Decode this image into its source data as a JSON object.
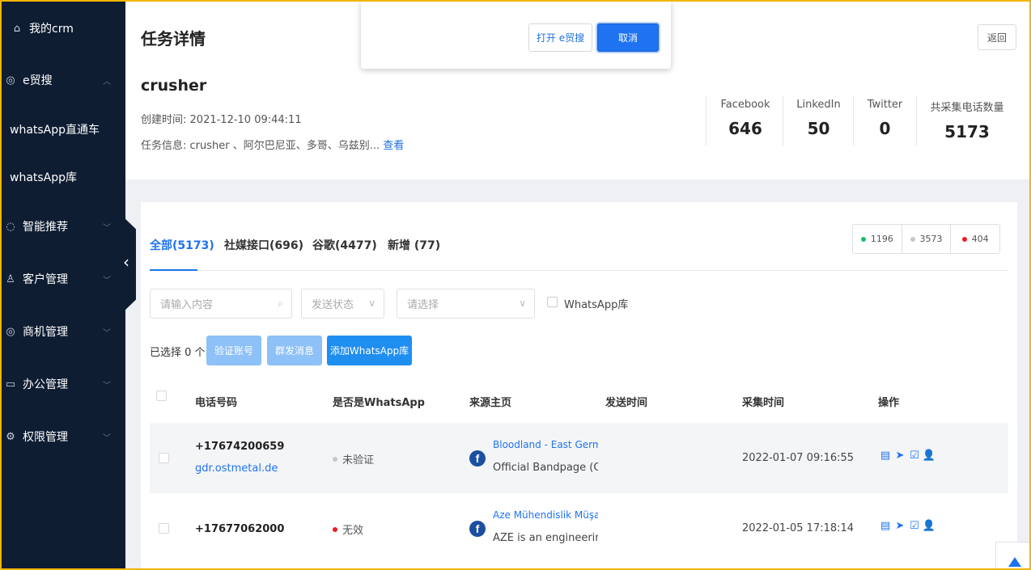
{
  "sidebar": {
    "home": "我的crm",
    "esearch": "e贸搜",
    "sub1": "whatsApp直通车",
    "sub2": "whatsApp库",
    "items": [
      "智能推荐",
      "客户管理",
      "商机管理",
      "办公管理",
      "权限管理"
    ]
  },
  "header": {
    "title": "任务详情",
    "return_label": "返回",
    "task_name": "crusher",
    "created_label": "创建时间:",
    "created_value": "2021-12-10 09:44:11",
    "info_label": "任务信息:",
    "info_value": "crusher 、阿尔巴尼亚、多哥、乌兹别...",
    "info_link": "查看",
    "stats": [
      {
        "label": "Facebook",
        "value": "646"
      },
      {
        "label": "LinkedIn",
        "value": "50"
      },
      {
        "label": "Twitter",
        "value": "0"
      },
      {
        "label": "共采集电话数量",
        "value": "5173"
      }
    ]
  },
  "modal": {
    "open_label": "打开 e贸搜",
    "cancel_label": "取消"
  },
  "tabs": [
    "全部(5173)",
    "社媒接口(696)",
    "谷歌(4477)",
    "新增 (77)"
  ],
  "status_counts": [
    {
      "value": "1196",
      "color": "#19be6b"
    },
    {
      "value": "3573",
      "color": "#c5c8ce"
    },
    {
      "value": "404",
      "color": "#ed1c24"
    }
  ],
  "filters": {
    "search_placeholder": "请输入内容",
    "send_status": "发送状态",
    "select": "请选择",
    "wa_lib": "WhatsApp库"
  },
  "actions": {
    "selected": "已选择 0 个",
    "verify": "验证账号",
    "mass": "群发消息",
    "add": "添加WhatsApp库"
  },
  "columns": [
    "电话号码",
    "是否是WhatsApp",
    "来源主页",
    "发送时间",
    "采集时间",
    "操作"
  ],
  "rows": [
    {
      "phone": "+17674200659",
      "domain": "gdr.ostmetal.de",
      "status": "未验证",
      "status_color": "#c5c8ce",
      "src_title": "Bloodland - East Germany",
      "src_desc": "Official Bandpage (Oldschool",
      "collect_time": "2022-01-07 09:16:55"
    },
    {
      "phone": "+17677062000",
      "domain": "",
      "status": "无效",
      "status_color": "#ed1c24",
      "src_title": "Aze Mühendislik Müşavirlik",
      "src_desc": "AZE is an engineering and",
      "collect_time": "2022-01-05 17:18:14"
    }
  ]
}
